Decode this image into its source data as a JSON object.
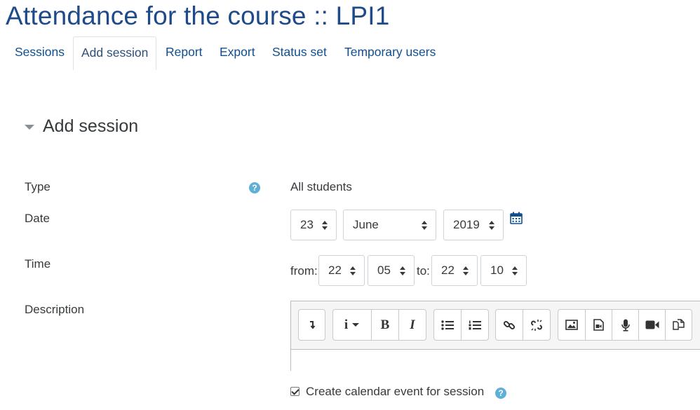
{
  "page": {
    "title": "Attendance for the course :: LPI1"
  },
  "tabs": [
    {
      "label": "Sessions",
      "active": false
    },
    {
      "label": "Add session",
      "active": true
    },
    {
      "label": "Report",
      "active": false
    },
    {
      "label": "Export",
      "active": false
    },
    {
      "label": "Status set",
      "active": false
    },
    {
      "label": "Temporary users",
      "active": false
    }
  ],
  "section": {
    "title": "Add session",
    "icon": "caret-down-icon"
  },
  "form": {
    "type": {
      "label": "Type",
      "value": "All students",
      "help_icon": "question-circle-icon",
      "help_glyph": "?"
    },
    "date": {
      "label": "Date",
      "day": "23",
      "month": "June",
      "year": "2019",
      "calendar_icon": "calendar-icon"
    },
    "time": {
      "label": "Time",
      "from_label": "from:",
      "from_hour": "22",
      "from_minute": "05",
      "to_label": "to:",
      "to_hour": "22",
      "to_minute": "10"
    },
    "description": {
      "label": "Description",
      "toolbar": [
        [
          "show-more-icon"
        ],
        [
          "info-style-icon",
          "bold-icon",
          "italic-icon"
        ],
        [
          "bullet-list-icon",
          "numbered-list-icon"
        ],
        [
          "link-icon",
          "unlink-icon"
        ],
        [
          "image-icon",
          "media-icon",
          "record-audio-icon",
          "record-video-icon",
          "manage-files-icon"
        ]
      ],
      "bold_glyph": "B",
      "italic_glyph": "I",
      "info_glyph": "i",
      "value": ""
    },
    "calendar_event": {
      "label": "Create calendar event for session",
      "checked": true,
      "help_glyph": "?"
    }
  },
  "colors": {
    "title": "#1f4a8a",
    "link": "#0f4f8f",
    "help": "#5fb0d6",
    "text": "#373a3c"
  }
}
